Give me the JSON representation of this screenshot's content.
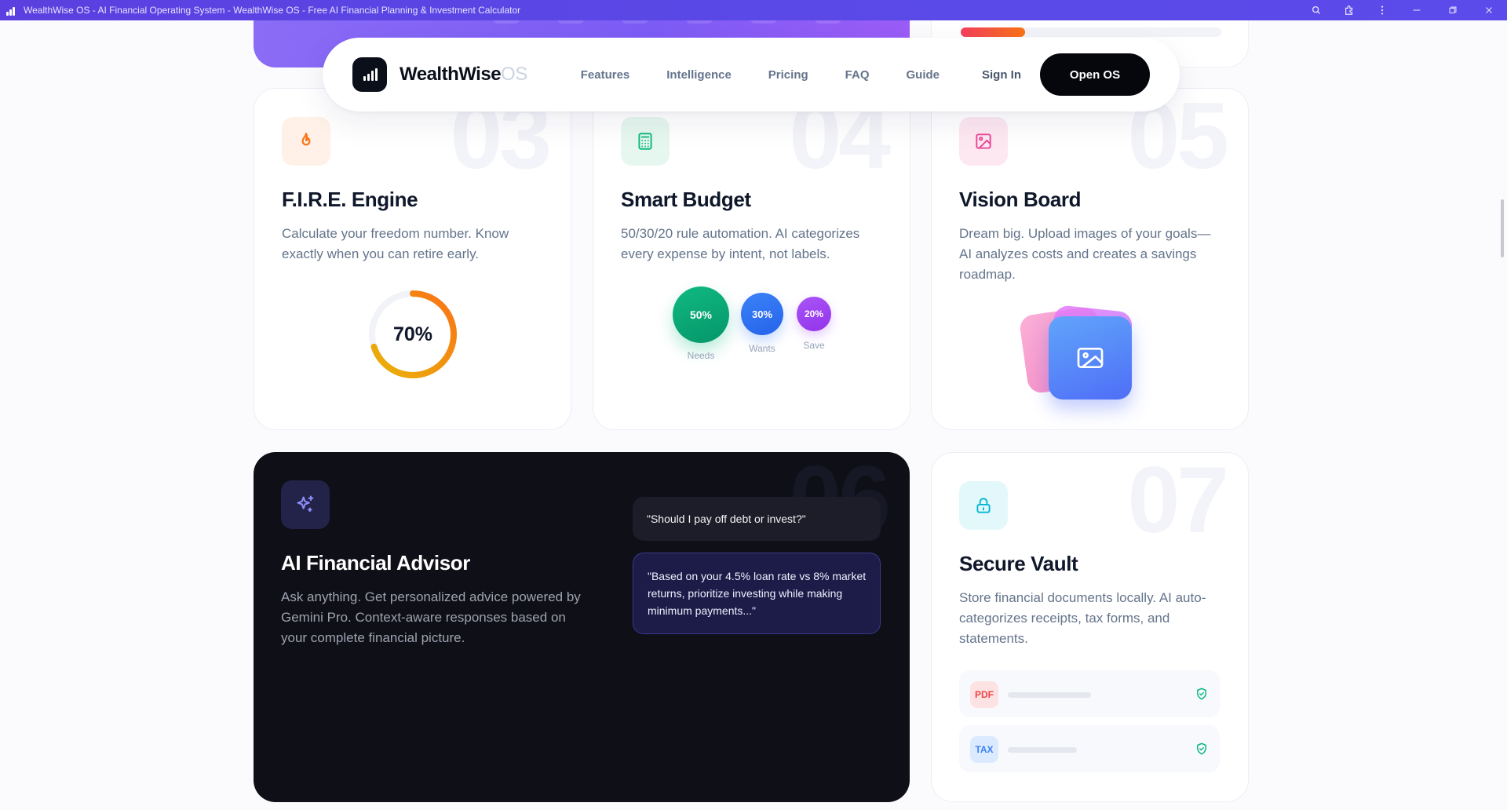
{
  "window": {
    "title": "WealthWise OS - AI Financial Operating System - WealthWise OS - Free AI Financial Planning & Investment Calculator"
  },
  "nav": {
    "brand_name": "WealthWise",
    "brand_suffix": "OS",
    "links": [
      "Features",
      "Intelligence",
      "Pricing",
      "FAQ",
      "Guide"
    ],
    "sign_in": "Sign In",
    "cta": "Open OS"
  },
  "cards": {
    "fire": {
      "number": "03",
      "title": "F.I.R.E. Engine",
      "description": "Calculate your freedom number. Know exactly when you can retire early.",
      "progress_label": "70%",
      "progress_value": 0.7,
      "icon": "flame-icon",
      "accent": "#f97316"
    },
    "budget": {
      "number": "04",
      "title": "Smart Budget",
      "description": "50/30/20 rule automation. AI categorizes every expense by intent, not labels.",
      "icon": "calculator-icon",
      "split": [
        {
          "percent": "50%",
          "label": "Needs",
          "color": "#10b981"
        },
        {
          "percent": "30%",
          "label": "Wants",
          "color": "#3b82f6"
        },
        {
          "percent": "20%",
          "label": "Save",
          "color": "#a855f7"
        }
      ]
    },
    "vision": {
      "number": "05",
      "title": "Vision Board",
      "description": "Dream big. Upload images of your goals—AI analyzes costs and creates a savings roadmap.",
      "icon": "image-icon"
    },
    "advisor": {
      "number": "06",
      "title": "AI Financial Advisor",
      "description": "Ask anything. Get personalized advice powered by Gemini Pro. Context-aware responses based on your complete financial picture.",
      "icon": "sparkles-icon",
      "chat_question": "\"Should I pay off debt or invest?\"",
      "chat_answer": "\"Based on your 4.5% loan rate vs 8% market returns, prioritize investing while making minimum payments...\""
    },
    "vault": {
      "number": "07",
      "title": "Secure Vault",
      "description": "Store financial documents locally. AI auto-categorizes receipts, tax forms, and statements.",
      "icon": "lock-icon",
      "files": [
        {
          "badge": "PDF",
          "color": "#ef4444",
          "bg": "#fde2e4"
        },
        {
          "badge": "TAX",
          "color": "#3b82f6",
          "bg": "#dbeafe"
        }
      ]
    }
  }
}
